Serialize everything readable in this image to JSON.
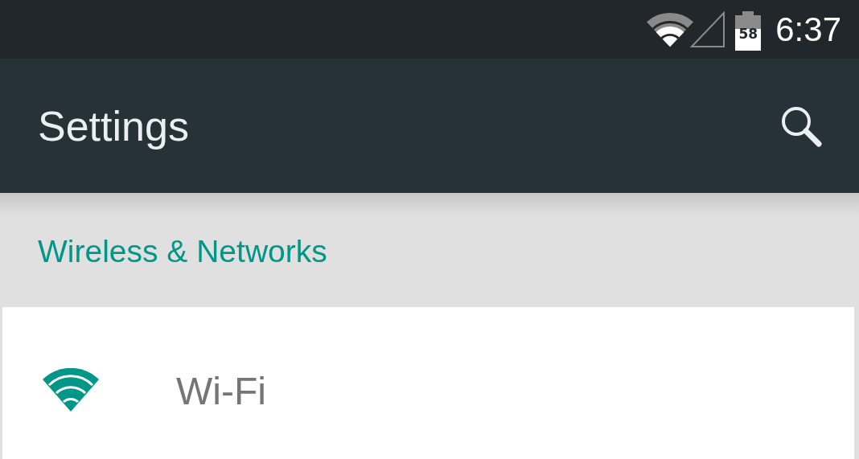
{
  "status_bar": {
    "battery_percent": "58",
    "time": "6:37"
  },
  "toolbar": {
    "title": "Settings"
  },
  "sections": [
    {
      "header": "Wireless & Networks",
      "items": [
        {
          "label": "Wi-Fi"
        }
      ]
    }
  ]
}
